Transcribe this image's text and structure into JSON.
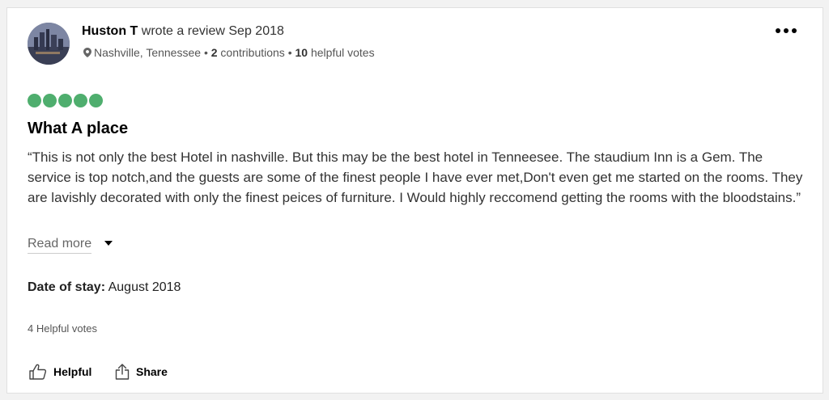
{
  "reviewer": {
    "name": "Huston T",
    "action": "wrote a review Sep 2018",
    "location": "Nashville, Tennessee",
    "separator": "•",
    "contributions_count": "2",
    "contributions_label": "contributions",
    "helpful_votes_count": "10",
    "helpful_votes_label": "helpful votes"
  },
  "review": {
    "rating": 5,
    "rating_max": 5,
    "rating_color": "#4fae6e",
    "title": "What A place",
    "text": "“This is not only the best Hotel in nashville. But this may be the best hotel in Tenneesee. The staudium Inn is a Gem. The service is top notch,and the guests are some of the finest people I have ever met,Don't even get me started on the rooms. They are lavishly decorated with only the finest peices of furniture. I Would highly reccomend getting the rooms with the bloodstains.”",
    "read_more_label": "Read more",
    "date_of_stay_label": "Date of stay:",
    "date_of_stay_value": "August 2018",
    "helpful_votes_text": "4 Helpful votes"
  },
  "actions": {
    "helpful_label": "Helpful",
    "share_label": "Share"
  },
  "icons": {
    "more": "more-options-icon",
    "location": "map-pin-icon",
    "expand": "caret-down-icon",
    "helpful": "thumbs-up-icon",
    "share": "share-icon"
  }
}
